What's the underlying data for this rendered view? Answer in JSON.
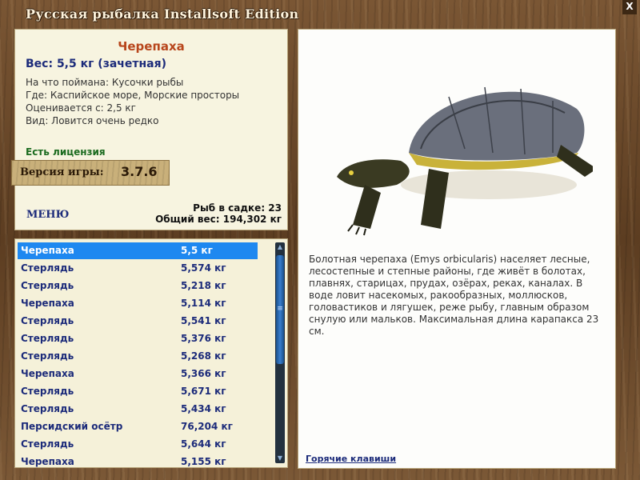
{
  "window": {
    "title": "Русская рыбалка Installsoft Edition",
    "close_label": "X"
  },
  "catch": {
    "name": "Черепаха",
    "weight": "Вес: 5,5 кг (зачетная)",
    "bait": "На что поймана: Кусочки рыбы",
    "location": "Где: Каспийское море, Морские просторы",
    "value": "Оценивается с: 2,5 кг",
    "rarity": "Вид: Ловится очень редко",
    "license": "Есть лицензия"
  },
  "version": {
    "label": "Версия игры:",
    "value": "3.7.6"
  },
  "menu_label": "МЕНЮ",
  "cage": {
    "count": "Рыб в садке: 23",
    "total": "Общий вес: 194,302 кг"
  },
  "fish_list": [
    {
      "name": "Черепаха",
      "weight": "5,5 кг",
      "selected": true
    },
    {
      "name": "Стерлядь",
      "weight": "5,574 кг"
    },
    {
      "name": "Стерлядь",
      "weight": "5,218 кг"
    },
    {
      "name": "Черепаха",
      "weight": "5,114 кг"
    },
    {
      "name": "Стерлядь",
      "weight": "5,541 кг"
    },
    {
      "name": "Стерлядь",
      "weight": "5,376 кг"
    },
    {
      "name": "Стерлядь",
      "weight": "5,268 кг"
    },
    {
      "name": "Черепаха",
      "weight": "5,366 кг"
    },
    {
      "name": "Стерлядь",
      "weight": "5,671 кг"
    },
    {
      "name": "Стерлядь",
      "weight": "5,434 кг"
    },
    {
      "name": "Персидский осётр",
      "weight": "76,204 кг"
    },
    {
      "name": "Стерлядь",
      "weight": "5,644 кг"
    },
    {
      "name": "Черепаха",
      "weight": "5,155 кг"
    }
  ],
  "description": "Болотная черепаха (Emys orbicularis) населяет лесные, лесостепные и степные районы, где живёт в болотах, плавнях, старицах, прудах, озёрах, реках, каналах. В воде ловит насекомых, ракообразных, моллюсков, головастиков и лягушек, реже рыбу, главным образом снулую или мальков. Максимальная длина карапакса 23 см.",
  "hotkeys_label": "Горячие клавиши",
  "colors": {
    "selection": "#1e88f0",
    "fish_name": "#b8461c",
    "list_text": "#1c2b7a",
    "license": "#1b6b1f"
  },
  "scrollbar_icon": "≡",
  "turtle_image": "turtle-photo"
}
